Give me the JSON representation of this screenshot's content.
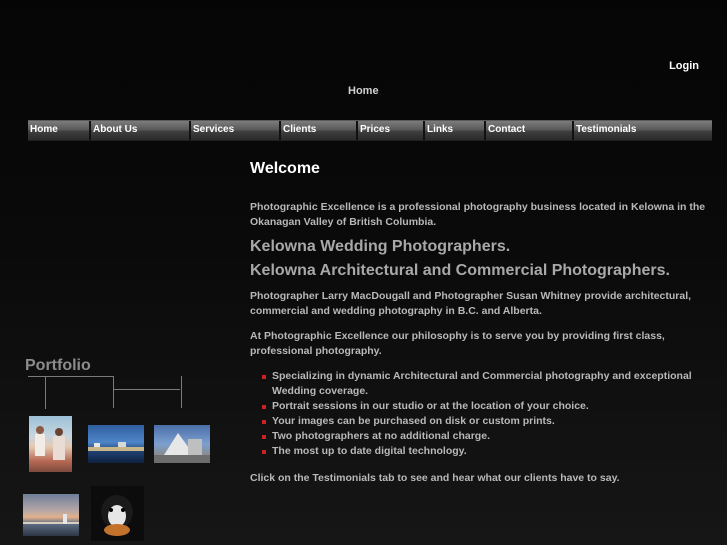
{
  "header": {
    "login_label": "Login",
    "breadcrumb": "Home"
  },
  "nav": {
    "items": [
      {
        "label": "Home"
      },
      {
        "label": "About Us"
      },
      {
        "label": "Services"
      },
      {
        "label": "Clients"
      },
      {
        "label": "Prices"
      },
      {
        "label": "Links"
      },
      {
        "label": "Contact"
      },
      {
        "label": "Testimonials"
      }
    ]
  },
  "main": {
    "title": "Welcome",
    "intro": "Photographic Excellence is a professional photography business located in Kelowna in the Okanagan Valley of British Columbia.",
    "heading1": "Kelowna Wedding Photographers.",
    "heading2": "Kelowna Architectural and Commercial Photographers.",
    "para2": "Photographer Larry MacDougall and Photographer Susan Whitney provide architectural, commercial and wedding photography in B.C. and Alberta.",
    "para3": "At Photographic Excellence our philosophy is to serve you by providing first class, professional photography.",
    "bullets": [
      "Specializing in dynamic Architectural and Commercial photography and exceptional Wedding coverage.",
      "Portrait sessions in our studio or at the location of your choice.",
      "Your images can be purchased on disk or custom prints.",
      "Two photographers at no additional charge.",
      "The most up to date digital technology."
    ],
    "footer_text": "Click on the Testimonials tab to see and hear what our clients have to say."
  },
  "portfolio": {
    "title": "Portfolio"
  },
  "colors": {
    "bullet": "#cc2222",
    "nav_top": "#7c7c7c",
    "nav_bottom": "#2a2a2a"
  }
}
